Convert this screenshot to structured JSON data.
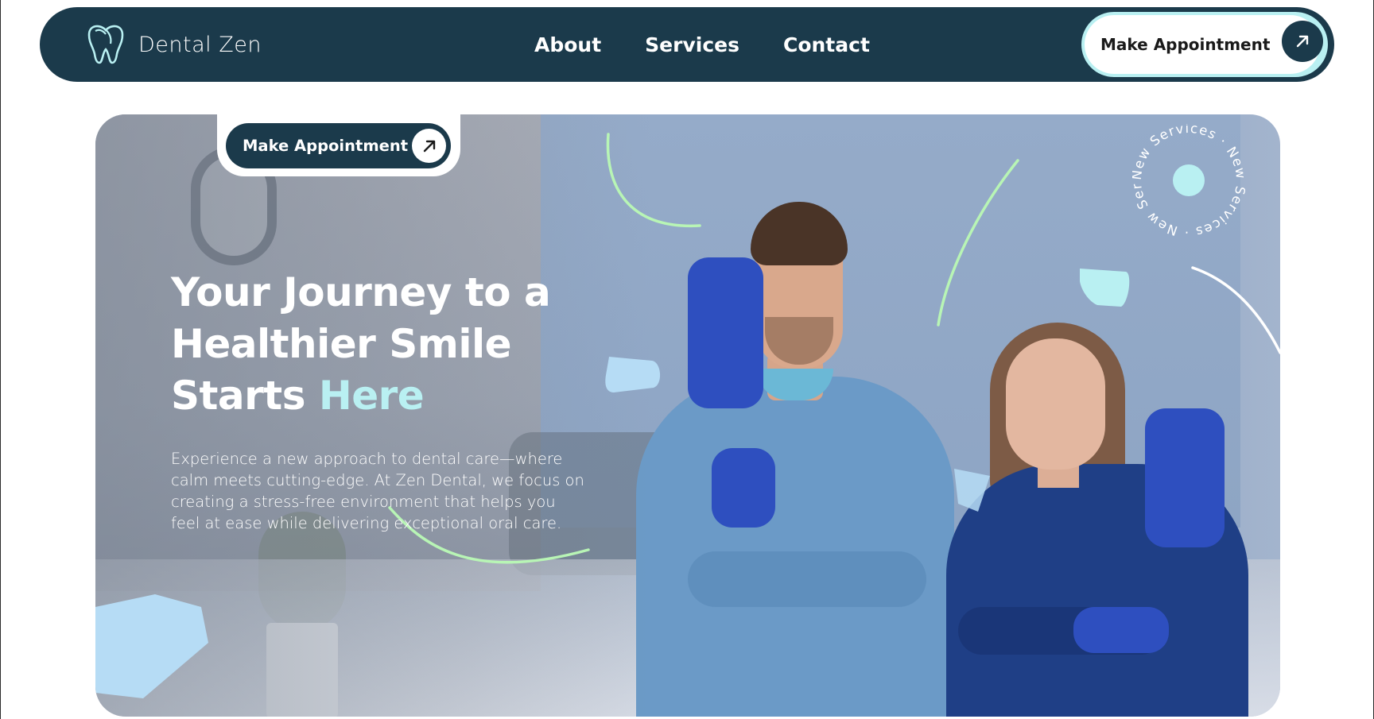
{
  "brand": {
    "name": "Dental Zen",
    "logo_icon": "tooth-icon"
  },
  "nav": {
    "links": [
      "About",
      "Services",
      "Contact"
    ],
    "cta_label": "Make Appointment",
    "cta_icon": "arrow-up-right-icon"
  },
  "hero": {
    "cta_label": "Make Appointment",
    "cta_icon": "arrow-up-right-icon",
    "title_line1": "Your Journey to a",
    "title_line2": "Healthier Smile",
    "title_line3_start": "Starts ",
    "title_line3_accent": "Here",
    "description": "Experience a new approach to dental care—where calm meets cutting-edge. At Zen Dental, we focus on creating a stress-free environment that helps you feel at ease while delivering exceptional oral care.",
    "badge_text": "New Services · New Services · New Services ·"
  },
  "colors": {
    "navy": "#1b3a4b",
    "accent_mint": "#b9f0f2",
    "light_blue": "#b6dcf5",
    "green_line": "#b8f5b5"
  }
}
